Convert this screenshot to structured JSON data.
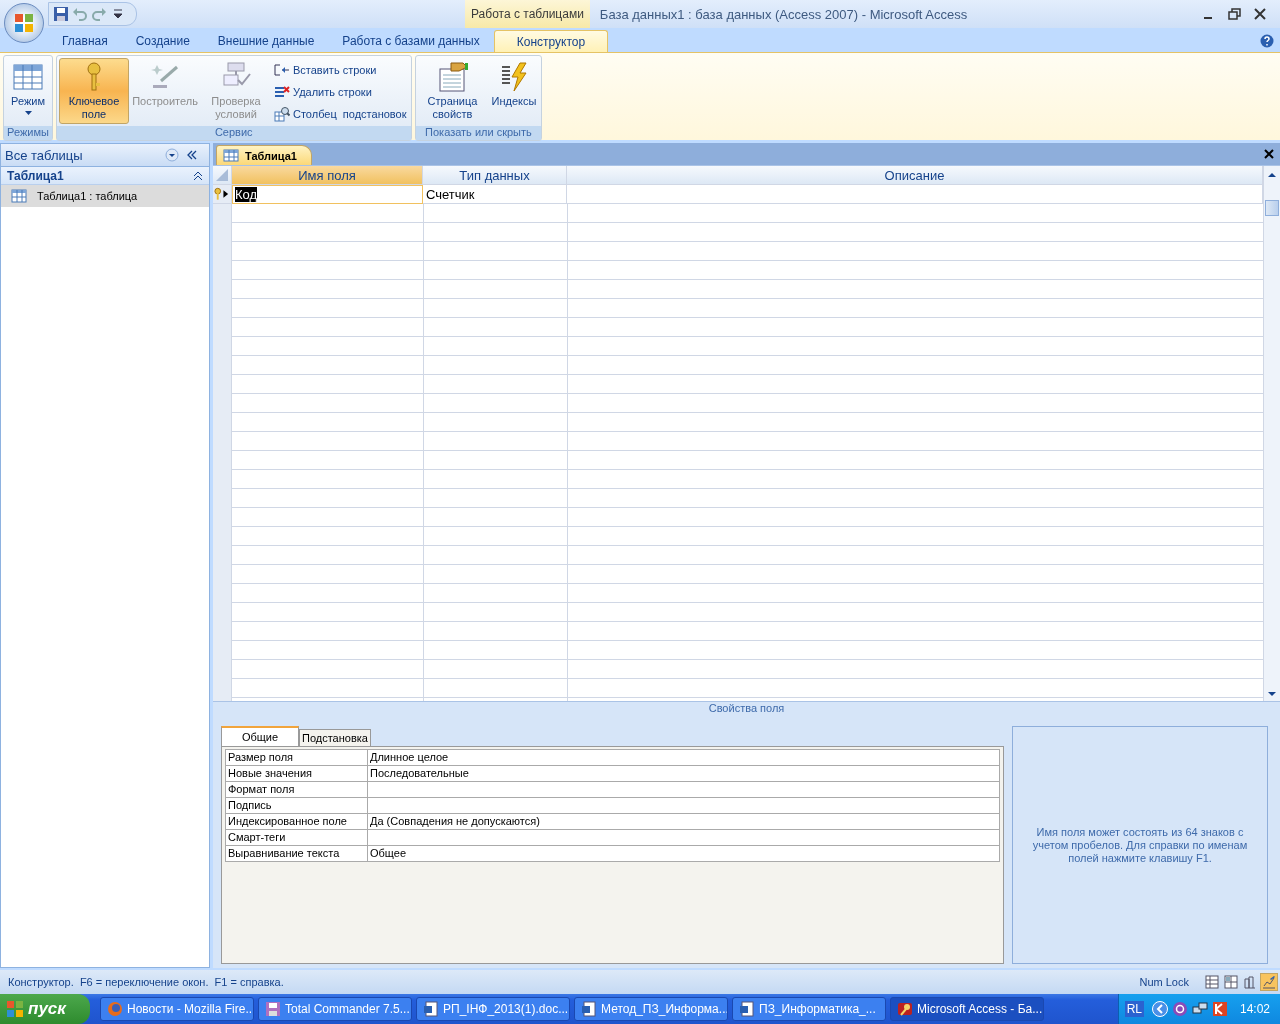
{
  "title_bar": {
    "contextual_tab": "Работа с таблицами",
    "title": "База данных1 : база данных (Access 2007) - Microsoft Access"
  },
  "ribbon_tabs": [
    {
      "label": "Главная",
      "selected": false
    },
    {
      "label": "Создание",
      "selected": false
    },
    {
      "label": "Внешние данные",
      "selected": false
    },
    {
      "label": "Работа с базами данных",
      "selected": false
    },
    {
      "label": "Конструктор",
      "selected": true
    }
  ],
  "ribbon_groups": [
    {
      "label": "Режимы",
      "items": [
        {
          "kind": "large",
          "label": "Режим",
          "dropdown": true,
          "selected": false,
          "disabled": false
        }
      ]
    },
    {
      "label": "Сервис",
      "items": [
        {
          "kind": "large",
          "label": "Ключевое поле",
          "selected": true,
          "disabled": false
        },
        {
          "kind": "large",
          "label": "Построитель",
          "selected": false,
          "disabled": true
        },
        {
          "kind": "large",
          "label": "Проверка условий",
          "selected": false,
          "disabled": true
        },
        {
          "kind": "small",
          "label": "Вставить строки",
          "selected": false,
          "disabled": false
        },
        {
          "kind": "small",
          "label": "Удалить строки",
          "selected": false,
          "disabled": false
        },
        {
          "kind": "small",
          "label": "Столбец  подстановок",
          "selected": false,
          "disabled": false
        }
      ]
    },
    {
      "label": "Показать или скрыть",
      "items": [
        {
          "kind": "large",
          "label": "Страница свойств",
          "selected": false,
          "disabled": false
        },
        {
          "kind": "large",
          "label": "Индексы",
          "selected": false,
          "disabled": false
        }
      ]
    }
  ],
  "navigation": {
    "header": "Все таблицы",
    "groups": [
      {
        "label": "Таблица1",
        "expanded": true,
        "items": [
          {
            "label": "Таблица1 : таблица",
            "selected": true
          }
        ]
      }
    ]
  },
  "document": {
    "tab": "Таблица1",
    "columns": [
      "Имя поля",
      "Тип данных",
      "Описание"
    ],
    "rows": [
      {
        "primary_key": true,
        "selected": true,
        "field_name": "Код",
        "data_type": "Счетчик"
      }
    ]
  },
  "field_properties": {
    "title": "Свойства поля",
    "tabs": [
      {
        "label": "Общие",
        "selected": true
      },
      {
        "label": "Подстановка",
        "selected": false
      }
    ],
    "rows": [
      {
        "label": "Размер поля",
        "value": "Длинное целое"
      },
      {
        "label": "Новые значения",
        "value": "Последовательные"
      },
      {
        "label": "Формат поля"
      },
      {
        "label": "Подпись"
      },
      {
        "label": "Индексированное поле",
        "value": "Да (Совпадения не допускаются)"
      },
      {
        "label": "Смарт-теги"
      },
      {
        "label": "Выравнивание текста",
        "value": "Общее"
      }
    ],
    "help": "Имя поля может состоять из 64 знаков с учетом пробелов.  Для справки по именам полей нажмите клавишу F1."
  },
  "status_bar": {
    "text": "Конструктор.  F6 = переключение окон.  F1 = справка.",
    "indicator": "Num Lock",
    "views": [
      {
        "selected": false
      },
      {
        "selected": false
      },
      {
        "selected": false
      },
      {
        "selected": true
      }
    ]
  },
  "taskbar": {
    "start": "пуск",
    "tasks": [
      {
        "label": "Новости - Mozilla Fire...",
        "selected": false
      },
      {
        "label": "Total Commander 7.5...",
        "selected": false
      },
      {
        "label": "РП_ІНФ_2013(1).doc...",
        "selected": false
      },
      {
        "label": "Метод_ПЗ_Информа...",
        "selected": false
      },
      {
        "label": "ПЗ_Информатика_...",
        "selected": false
      },
      {
        "label": "Microsoft Access - Ба...",
        "selected": true
      }
    ],
    "language": "RL",
    "clock": "14:02"
  }
}
